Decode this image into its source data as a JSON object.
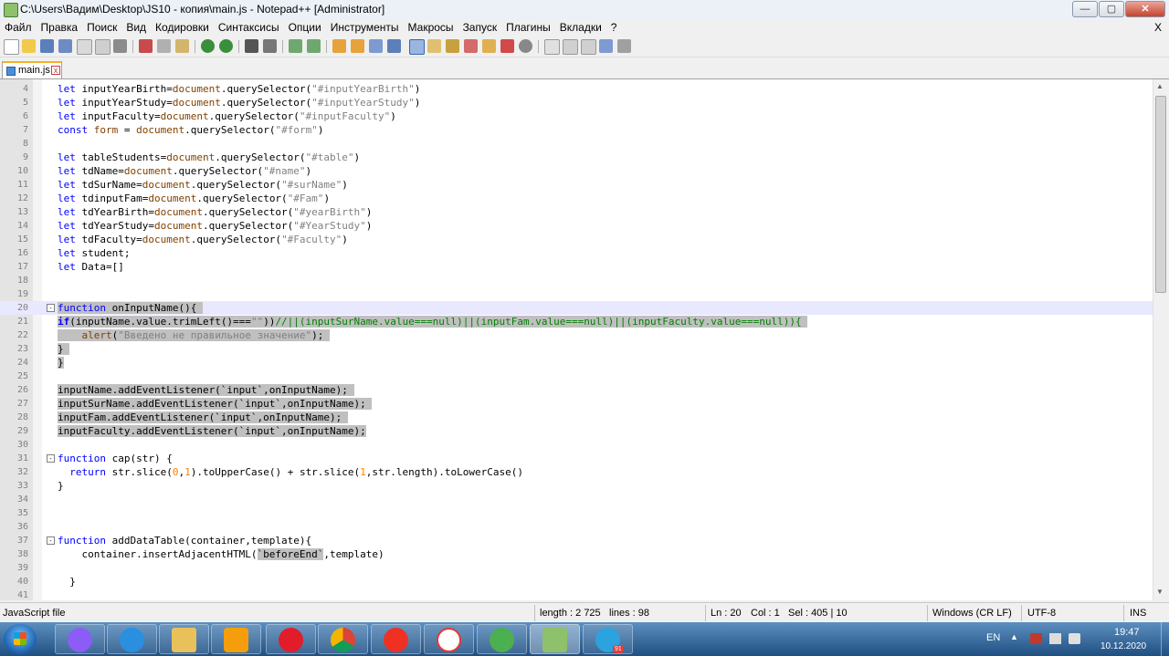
{
  "window": {
    "title": "C:\\Users\\Вадим\\Desktop\\JS10 - копия\\main.js - Notepad++ [Administrator]",
    "min": "—",
    "max": "▢",
    "close": "✕"
  },
  "menu": [
    "Файл",
    "Правка",
    "Поиск",
    "Вид",
    "Кодировки",
    "Синтаксисы",
    "Опции",
    "Инструменты",
    "Макросы",
    "Запуск",
    "Плагины",
    "Вкладки",
    "?"
  ],
  "menu_close": "X",
  "tab": {
    "label": "main.js",
    "close": "x"
  },
  "code_lines": [
    {
      "n": "4",
      "html": "<span class='kw'>let</span> inputYearBirth=<span class='obj'>document</span>.querySelector(<span class='str'>\"#inputYearBirth\"</span>)"
    },
    {
      "n": "5",
      "html": "<span class='kw'>let</span> inputYearStudy=<span class='obj'>document</span>.querySelector(<span class='str'>\"#inputYearStudy\"</span>)"
    },
    {
      "n": "6",
      "html": "<span class='kw'>let</span> inputFaculty=<span class='obj'>document</span>.querySelector(<span class='str'>\"#inputFaculty\"</span>)"
    },
    {
      "n": "7",
      "html": "<span class='kw'>const</span> <span class='obj'>form</span> = <span class='obj'>document</span>.querySelector(<span class='str'>\"#form\"</span>)"
    },
    {
      "n": "8",
      "html": ""
    },
    {
      "n": "9",
      "html": "<span class='kw'>let</span> tableStudents=<span class='obj'>document</span>.querySelector(<span class='str'>\"#table\"</span>)"
    },
    {
      "n": "10",
      "html": "<span class='kw'>let</span> tdName=<span class='obj'>document</span>.querySelector(<span class='str'>\"#name\"</span>)"
    },
    {
      "n": "11",
      "html": "<span class='kw'>let</span> tdSurName=<span class='obj'>document</span>.querySelector(<span class='str'>\"#surName\"</span>)"
    },
    {
      "n": "12",
      "html": "<span class='kw'>let</span> tdinputFam=<span class='obj'>document</span>.querySelector(<span class='str'>\"#Fam\"</span>)"
    },
    {
      "n": "13",
      "html": "<span class='kw'>let</span> tdYearBirth=<span class='obj'>document</span>.querySelector(<span class='str'>\"#yearBirth\"</span>)"
    },
    {
      "n": "14",
      "html": "<span class='kw'>let</span> tdYearStudy=<span class='obj'>document</span>.querySelector(<span class='str'>\"#YearStudy\"</span>)"
    },
    {
      "n": "15",
      "html": "<span class='kw'>let</span> tdFaculty=<span class='obj'>document</span>.querySelector(<span class='str'>\"#Faculty\"</span>)"
    },
    {
      "n": "16",
      "html": "<span class='kw'>let</span> student;"
    },
    {
      "n": "17",
      "html": "<span class='kw'>let</span> Data=[]"
    },
    {
      "n": "18",
      "html": ""
    },
    {
      "n": "19",
      "html": ""
    },
    {
      "n": "20",
      "cur": true,
      "fold": "-",
      "html": "<span class='sel'><span class='kw'>function</span> onInputName(){ </span>"
    },
    {
      "n": "21",
      "html": "<span class='sel'><span class='kwb'>if</span>(inputName.value.trimLeft()===<span class='str'>\"\"</span>))<span class='cmt'>//||(inputSurName.value===null)||(inputFam.value===null)||(inputFaculty.value===null)){</span> </span>"
    },
    {
      "n": "22",
      "html": "<span class='sel'>    <span class='obj'>alert</span>(<span class='str'>\"Введено не правильное значение\"</span>); </span>"
    },
    {
      "n": "23",
      "html": "<span class='sel'>} </span>"
    },
    {
      "n": "24",
      "html": "<span class='sel'>}</span>"
    },
    {
      "n": "25",
      "html": ""
    },
    {
      "n": "26",
      "html": "<span class='sel'>inputName.addEventListener(`input`,onInputName); </span>"
    },
    {
      "n": "27",
      "html": "<span class='sel'>inputSurName.addEventListener(`input`,onInputName); </span>"
    },
    {
      "n": "28",
      "html": "<span class='sel'>inputFam.addEventListener(`input`,onInputName); </span>"
    },
    {
      "n": "29",
      "html": "<span class='sel'>inputFaculty.addEventListener(`input`,onInputName);</span>"
    },
    {
      "n": "30",
      "html": ""
    },
    {
      "n": "31",
      "fold": "-",
      "html": "<span class='kw'>function</span> cap(str) {"
    },
    {
      "n": "32",
      "html": "  <span class='kw'>return</span> str.slice(<span class='num'>0</span>,<span class='num'>1</span>).toUpperCase() + str.slice(<span class='num'>1</span>,str.length).toLowerCase()"
    },
    {
      "n": "33",
      "html": "}"
    },
    {
      "n": "34",
      "html": ""
    },
    {
      "n": "35",
      "html": ""
    },
    {
      "n": "36",
      "html": ""
    },
    {
      "n": "37",
      "fold": "-",
      "html": "<span class='kw'>function</span> addDataTable(container,template){"
    },
    {
      "n": "38",
      "html": "    container.insertAdjacentHTML(<span class='sel'>`beforeEnd`</span>,template)"
    },
    {
      "n": "39",
      "html": ""
    },
    {
      "n": "40",
      "html": "  }"
    },
    {
      "n": "41",
      "html": ""
    }
  ],
  "status": {
    "lang": "JavaScript file",
    "length": "length : 2 725",
    "lines": "lines : 98",
    "ln": "Ln : 20",
    "col": "Col : 1",
    "sel": "Sel : 405 | 10",
    "eol": "Windows (CR LF)",
    "enc": "UTF-8",
    "mode": "INS"
  },
  "tray": {
    "lang": "EN",
    "time": "19:47",
    "date": "10.12.2020",
    "badge": "91"
  },
  "colors": {
    "accent_tab": "#f7b024",
    "selection": "#c0c0c0",
    "current_line": "#e8e8ff",
    "keyword": "#0000ff",
    "string": "#808080",
    "comment": "#008000",
    "number": "#ff8000"
  }
}
